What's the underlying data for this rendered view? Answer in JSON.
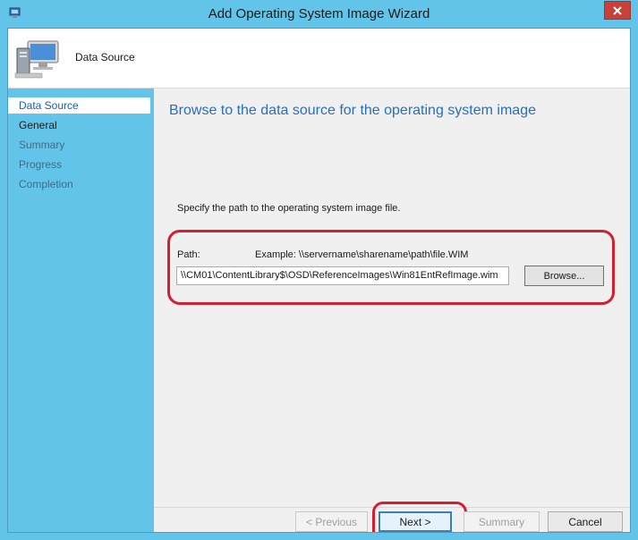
{
  "window": {
    "title": "Add Operating System Image Wizard"
  },
  "header": {
    "title": "Data Source",
    "icon": "computer-monitor-icon"
  },
  "sidebar": {
    "items": [
      {
        "label": "Data Source",
        "state": "active"
      },
      {
        "label": "General",
        "state": "current"
      },
      {
        "label": "Summary",
        "state": "pending"
      },
      {
        "label": "Progress",
        "state": "pending"
      },
      {
        "label": "Completion",
        "state": "pending"
      }
    ]
  },
  "main": {
    "heading": "Browse to the data source for the operating system image",
    "instruction": "Specify the path to the operating system image file.",
    "path_label": "Path:",
    "example": "Example: \\\\servername\\sharename\\path\\file.WIM",
    "path_value": "\\\\CM01\\ContentLibrary$\\OSD\\ReferenceImages\\Win81EntRefImage.wim",
    "browse_label": "Browse..."
  },
  "footer": {
    "previous_label": "< Previous",
    "next_label": "Next >",
    "summary_label": "Summary",
    "cancel_label": "Cancel"
  },
  "colors": {
    "titlebar": "#62c4e8",
    "heading": "#2a6eb8",
    "highlight": "#d22030",
    "close": "#c7403a"
  }
}
